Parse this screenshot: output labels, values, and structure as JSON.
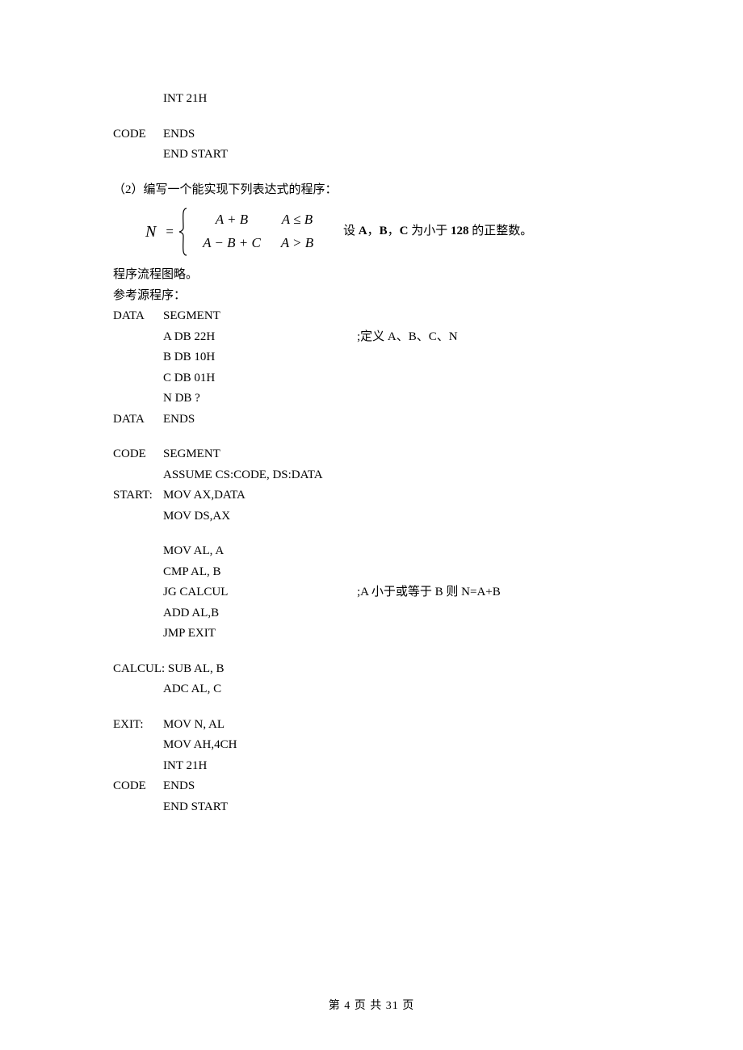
{
  "top_code": {
    "l1": "INT 21H",
    "l2": "",
    "l3_label": "CODE",
    "l3_inst": "ENDS",
    "l4_inst": "END START"
  },
  "problem": {
    "prompt": "（2）编写一个能实现下列表达式的程序：",
    "formula": {
      "N": "N",
      "eq": "=",
      "case1_expr": "A + B",
      "case1_cond": "A ≤ B",
      "case2_expr": "A − B + C",
      "case2_cond": "A > B"
    },
    "desc_prefix": "设 ",
    "desc_A": "A",
    "desc_sep1": "，",
    "desc_B": "B",
    "desc_sep2": "，",
    "desc_C": "C",
    "desc_mid": " 为小于 ",
    "desc_128": "128",
    "desc_suffix": " 的正整数。",
    "flow_note": "程序流程图略。",
    "ref_source": "参考源程序："
  },
  "code": {
    "data_seg_label": "DATA",
    "data_seg_kw": "SEGMENT",
    "a_def": "A DB 22H",
    "a_comment": ";定义 A、B、C、N",
    "b_def": "B DB 10H",
    "c_def": "C DB 01H",
    "n_def": "N DB ?",
    "data_ends_label": "DATA",
    "data_ends": "ENDS",
    "code_seg_label": "CODE",
    "code_seg_kw": "SEGMENT",
    "assume": "ASSUME CS:CODE, DS:DATA",
    "start_label": "START:",
    "mov_ax": "MOV AX,DATA",
    "mov_ds": "MOV DS,AX",
    "mov_al_a": "MOV AL, A",
    "cmp": "CMP AL, B",
    "jg": "JG CALCUL",
    "jg_comment": ";A 小于或等于 B 则 N=A+B",
    "add": "ADD AL,B",
    "jmp": "JMP EXIT",
    "calcul_label": "CALCUL:",
    "sub": "SUB AL, B",
    "adc": "ADC AL, C",
    "exit_label": "EXIT:",
    "mov_n": "MOV N, AL",
    "mov_ah": "MOV AH,4CH",
    "int21": "INT 21H",
    "code_ends_label": "CODE",
    "code_ends": "ENDS",
    "end_start": "END START"
  },
  "footer": "第 4 页 共 31 页"
}
